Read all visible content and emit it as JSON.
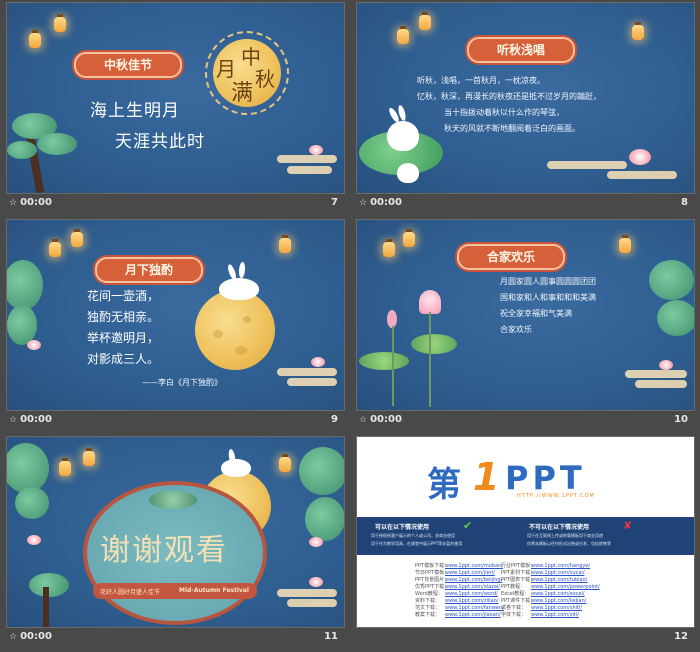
{
  "slides": [
    {
      "num": "7",
      "time": "00:00",
      "title": "中秋佳节",
      "emblem": [
        "月",
        "满",
        "中",
        "秋"
      ],
      "lines": [
        "海上生明月",
        "天涯共此时"
      ]
    },
    {
      "num": "8",
      "time": "00:00",
      "title": "听秋浅唱",
      "lines": [
        "听秋，浅唱，一首秋月，一枕凉夜。",
        "忆秋，秋深，再漫长的秋夜还是抵不过岁月的蹁跹，",
        "当十指拨动着秋以什么作的琴弦，",
        "秋天的风就不断地翻阅着泛白的画面。"
      ]
    },
    {
      "num": "9",
      "time": "00:00",
      "title": "月下独酌",
      "lines": [
        "花间一壶酒，",
        "独酌无相亲。",
        "举杯邀明月，",
        "对影成三人。"
      ],
      "source": "——李白《月下独酌》"
    },
    {
      "num": "10",
      "time": "00:00",
      "title": "合家欢乐",
      "lines": [
        "月圆家圆人圆事圆圆圆团团",
        "国和家和人和事和和和美满",
        "祝全家幸福和气美满",
        "合家欢乐"
      ]
    },
    {
      "num": "11",
      "time": "00:00",
      "title": "谢谢观看",
      "sub_left": "花好人圆好月盛人佳节",
      "sub_right": "Mid-Autumn Festival"
    },
    {
      "num": "12",
      "time": "",
      "logo_main": "第",
      "logo_one": "1",
      "logo_ppt": "PPT",
      "logo_url": "HTTP://WWW.1PPT.COM",
      "can_title": "可以在以下情况使用",
      "cannot_title": "不可以在以下情况使用",
      "can_items": [
        "用于授权给客户展示的个人或公司，非商业使用",
        "用于作为教学用具，在课堂中展示PPT等非盈利使用"
      ],
      "cannot_items": [
        "用于在互联网上传或转载模板用于商业用途",
        "仅将本模板以任何形式出售或分发，包括转售等"
      ],
      "links_left": [
        [
          "PPT模板下载：",
          "www.1ppt.com/moban/"
        ],
        [
          "节日PPT模板：",
          "www.1ppt.com/jieri/"
        ],
        [
          "PPT背景图片：",
          "www.1ppt.com/beijing/"
        ],
        [
          "优秀PPT下载：",
          "www.1ppt.com/xiazai/"
        ],
        [
          "Word教程：",
          "www.1ppt.com/word/"
        ],
        [
          "资料下载：",
          "www.1ppt.com/ziliao/"
        ],
        [
          "范文下载：",
          "www.1ppt.com/fanwen/"
        ],
        [
          "教案下载：",
          "www.1ppt.com/jiaoan/"
        ]
      ],
      "links_right": [
        [
          "行业PPT模板：",
          "www.1ppt.com/hangye/"
        ],
        [
          "PPT素材下载：",
          "www.1ppt.com/sucai/"
        ],
        [
          "PPT图表下载：",
          "www.1ppt.com/tubiao/"
        ],
        [
          "PPT教程：",
          "www.1ppt.com/powerpoint/"
        ],
        [
          "Excel教程：",
          "www.1ppt.com/excel/"
        ],
        [
          "PPT课件下载：",
          "www.1ppt.com/kejian/"
        ],
        [
          "试卷下载：",
          "www.1ppt.com/shiti/"
        ],
        [
          "字体下载：",
          "www.1ppt.com/ziti/"
        ]
      ]
    }
  ]
}
